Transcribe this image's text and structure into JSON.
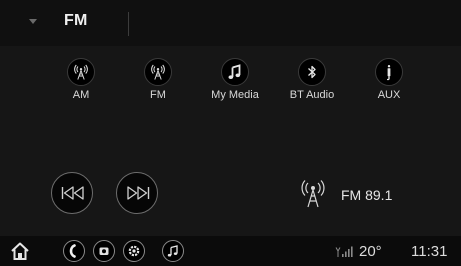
{
  "header": {
    "title": "FM",
    "menu_icon": "caret-down-icon"
  },
  "sources": [
    {
      "label": "AM",
      "icon": "radio-antenna-icon"
    },
    {
      "label": "FM",
      "icon": "radio-antenna-icon"
    },
    {
      "label": "My Media",
      "icon": "music-note-icon"
    },
    {
      "label": "BT Audio",
      "icon": "bluetooth-icon"
    },
    {
      "label": "AUX",
      "icon": "aux-cable-icon"
    }
  ],
  "transport": {
    "previous_icon": "skip-previous-icon",
    "next_icon": "skip-next-icon"
  },
  "now_playing": {
    "station": "FM 89.1",
    "icon": "radio-antenna-icon"
  },
  "bottom_bar": {
    "icons": [
      "home-icon",
      "phone-icon",
      "camera-icon",
      "settings-icon",
      "music-note-icon"
    ],
    "signal_icon": "cell-signal-icon",
    "temperature": "20°",
    "time": "11:31"
  },
  "colors": {
    "background": "#161616",
    "text": "#e8e8e8",
    "outline": "#6d6d6d"
  }
}
